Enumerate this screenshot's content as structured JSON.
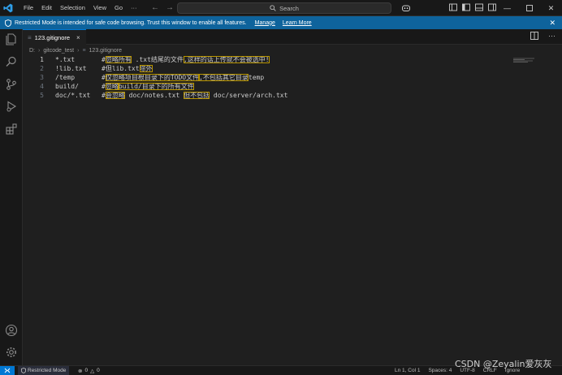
{
  "titlebar": {
    "menu": [
      "File",
      "Edit",
      "Selection",
      "View",
      "Go",
      "···"
    ],
    "search_label": "Search"
  },
  "banner": {
    "message": "Restricted Mode is intended for safe code browsing. Trust this window to enable all features.",
    "manage_label": "Manage",
    "learn_more_label": "Learn More"
  },
  "tab": {
    "title": "123.gitignore",
    "close": "×"
  },
  "breadcrumb": {
    "drive": "D:",
    "folder": "gitcode_test",
    "file": "123.gitignore"
  },
  "editor": {
    "lines": [
      {
        "num": "1",
        "code": "*.txt",
        "comment_prefix": "#",
        "parts": [
          "忽略所有",
          " .txt结尾的文件",
          ",这样的话上传就不会被选中!"
        ]
      },
      {
        "num": "2",
        "code": "!lib.txt",
        "comment_prefix": "#",
        "parts": [
          "但lib.txt",
          "除外"
        ]
      },
      {
        "num": "3",
        "code": "/temp",
        "comment_prefix": "#",
        "parts": [
          "仅忽略项目根目录下的TODO文件",
          ",不包括其它目录",
          "temp"
        ]
      },
      {
        "num": "4",
        "code": "build/",
        "comment_prefix": "#",
        "parts": [
          "忽略",
          "build/目录下的所有文件"
        ]
      },
      {
        "num": "5",
        "code": "doc/*.txt",
        "comment_prefix": "#",
        "parts": [
          "会忽略",
          " doc/notes.txt ",
          "但不包括",
          " doc/server/arch.txt"
        ]
      }
    ]
  },
  "statusbar": {
    "restricted": "Restricted Mode",
    "errors": "0",
    "warnings": "0",
    "position": "Ln 1, Col 1",
    "spaces": "Spaces: 4",
    "encoding": "UTF-8",
    "eol": "CRLF",
    "language": "Ignore"
  },
  "watermark": "CSDN @Zeyalin爱灰灰",
  "colors": {
    "accent": "#0078d4",
    "banner": "#0e639c",
    "highlight_border": "#b89500"
  }
}
